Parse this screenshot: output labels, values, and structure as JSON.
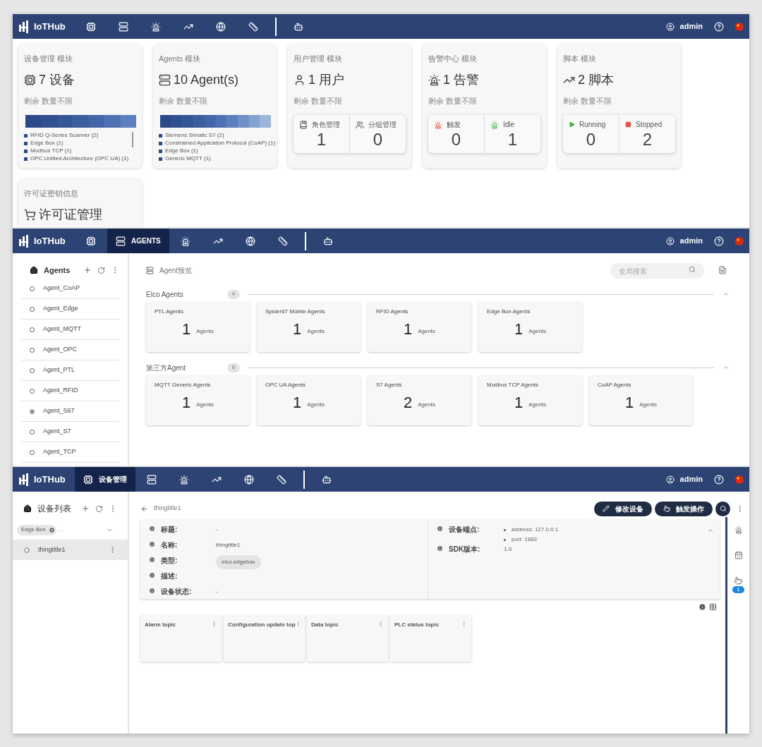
{
  "dashboard_view": {
    "navbar": {
      "brand": "IoTHub",
      "user": "admin",
      "items": [
        {
          "kind": "devices",
          "selected": false
        },
        {
          "kind": "agents",
          "selected": false
        },
        {
          "kind": "alarms",
          "selected": false
        },
        {
          "kind": "scripts",
          "selected": false
        },
        {
          "kind": "globe",
          "selected": false
        },
        {
          "kind": "rules",
          "selected": false
        },
        {
          "kind": "robot",
          "selected": false
        }
      ]
    },
    "modules": [
      {
        "kind": "breakdown",
        "title": "设备管理 模块",
        "headline": "7 设备",
        "remaining": "剩余 数量不限",
        "legend": [
          "RFID Q-Series Scanner (2)",
          "Edge Box (1)",
          "Modbus TCP (1)",
          "OPC Unified Architecture (OPC UA) (1)"
        ]
      },
      {
        "kind": "breakdown",
        "title": "Agents 模块",
        "headline": "10 Agent(s)",
        "remaining": "剩余 数量不限",
        "legend": [
          "Siemens Simatic S7 (2)",
          "Constrained Application Protocol (CoAP) (1)",
          "Edge Box (1)",
          "Generic MQTT (1)"
        ]
      },
      {
        "kind": "stats",
        "title": "用户管理 模块",
        "headline": "1 用户",
        "remaining": "剩余 数量不限",
        "stats": [
          {
            "kind": "roles",
            "label": "角色管理",
            "value": "1"
          },
          {
            "kind": "groups",
            "label": "分组管理",
            "value": "0"
          }
        ]
      },
      {
        "kind": "stats",
        "title": "告警中心 模块",
        "headline": "1 告警",
        "remaining": "剩余 数量不限",
        "stats": [
          {
            "kind": "alarm_active",
            "label": "触发",
            "value": "0"
          },
          {
            "kind": "alarm_idle",
            "label": "Idle",
            "value": "1"
          }
        ]
      },
      {
        "kind": "stats",
        "title": "脚本 模块",
        "headline": "2 脚本",
        "remaining": "剩余 数量不限",
        "stats": [
          {
            "kind": "running",
            "label": "Running",
            "value": "0"
          },
          {
            "kind": "stopped",
            "label": "Stopped",
            "value": "2"
          }
        ]
      },
      {
        "kind": "license",
        "title": "许可证密钥信息",
        "headline": "许可证管理"
      }
    ]
  },
  "agents_view": {
    "navbar": {
      "brand": "IoTHub",
      "user": "admin",
      "items": [
        {
          "kind": "devices",
          "selected": false
        },
        {
          "kind": "agents",
          "selected": true,
          "label": "AGENTS"
        },
        {
          "kind": "alarms",
          "selected": false
        },
        {
          "kind": "scripts",
          "selected": false
        },
        {
          "kind": "globe",
          "selected": false
        },
        {
          "kind": "rules",
          "selected": false
        },
        {
          "kind": "robot",
          "selected": false
        }
      ]
    },
    "sidebar": {
      "title": "Agents",
      "items": [
        {
          "label": "Agent_CoAP",
          "active": false
        },
        {
          "label": "Agent_Edge",
          "active": false
        },
        {
          "label": "Agent_MQTT",
          "active": false
        },
        {
          "label": "Agent_OPC",
          "active": false
        },
        {
          "label": "Agent_PTL",
          "active": false
        },
        {
          "label": "Agent_RFID",
          "active": false
        },
        {
          "label": "Agent_S67",
          "active": true
        },
        {
          "label": "Agent_S7",
          "active": false
        },
        {
          "label": "Agent_TCP",
          "active": false
        }
      ]
    },
    "title": "Agent预览",
    "search": {
      "placeholder": "全局搜索"
    },
    "groups": [
      {
        "name": "Elco Agents",
        "count": "4",
        "expanded": true,
        "cards": [
          {
            "title": "PTL Agents",
            "value": "1",
            "unit": "Agents"
          },
          {
            "title": "Spider67 Mobile Agents",
            "value": "1",
            "unit": "Agents"
          },
          {
            "title": "RFID Agents",
            "value": "1",
            "unit": "Agents"
          },
          {
            "title": "Edge Box Agents",
            "value": "1",
            "unit": "Agents"
          }
        ]
      },
      {
        "name": "第三方Agent",
        "count": "6",
        "expanded": true,
        "cards": [
          {
            "title": "MQTT Generic Agents",
            "value": "1",
            "unit": "Agents"
          },
          {
            "title": "OPC UA Agents",
            "value": "1",
            "unit": "Agents"
          },
          {
            "title": "S7 Agents",
            "value": "2",
            "unit": "Agents"
          },
          {
            "title": "Modbus TCP Agents",
            "value": "1",
            "unit": "Agents"
          },
          {
            "title": "CoAP Agents",
            "value": "1",
            "unit": "Agents"
          }
        ]
      }
    ]
  },
  "device_view": {
    "navbar": {
      "brand": "IoTHub",
      "user": "admin",
      "items": [
        {
          "kind": "devices",
          "selected": true,
          "label": "设备管理"
        },
        {
          "kind": "agents",
          "selected": false
        },
        {
          "kind": "alarms",
          "selected": false
        },
        {
          "kind": "scripts",
          "selected": false
        },
        {
          "kind": "globe",
          "selected": false
        },
        {
          "kind": "rules",
          "selected": false
        },
        {
          "kind": "robot",
          "selected": false
        }
      ]
    },
    "sidebar": {
      "title": "设备列表",
      "filter_chip": "Edge Box",
      "filter_more": "...",
      "items": [
        {
          "label": "thingtitle1",
          "selected": true
        }
      ]
    },
    "back_title": "thingtitle1",
    "buttons": [
      {
        "kind": "edit",
        "label": "修改设备"
      },
      {
        "kind": "trigger",
        "label": "触发操作"
      }
    ],
    "info_left": [
      {
        "kind": "text",
        "label": "标题:",
        "value": "-"
      },
      {
        "kind": "text",
        "label": "名称:",
        "value": "thingtitle1"
      },
      {
        "kind": "chip",
        "label": "类型:",
        "value": "elco.edgebox"
      },
      {
        "kind": "text",
        "label": "描述:"
      },
      {
        "kind": "text",
        "label": "设备状态:",
        "value": "-"
      }
    ],
    "info_right": [
      {
        "kind": "list",
        "label": "设备端点:",
        "items": [
          "address: 127.0.0.1",
          "port: 1883"
        ]
      },
      {
        "kind": "text",
        "label": "SDK版本:",
        "value": "1.0"
      }
    ],
    "topics": [
      {
        "title": "Alarm topic"
      },
      {
        "title": "Configuration update top"
      },
      {
        "title": "Data topic"
      },
      {
        "title": "PLC status topic"
      }
    ],
    "rail": [
      {
        "kind": "alarm"
      },
      {
        "kind": "calendar"
      },
      {
        "kind": "tap",
        "badge": "1"
      }
    ]
  }
}
